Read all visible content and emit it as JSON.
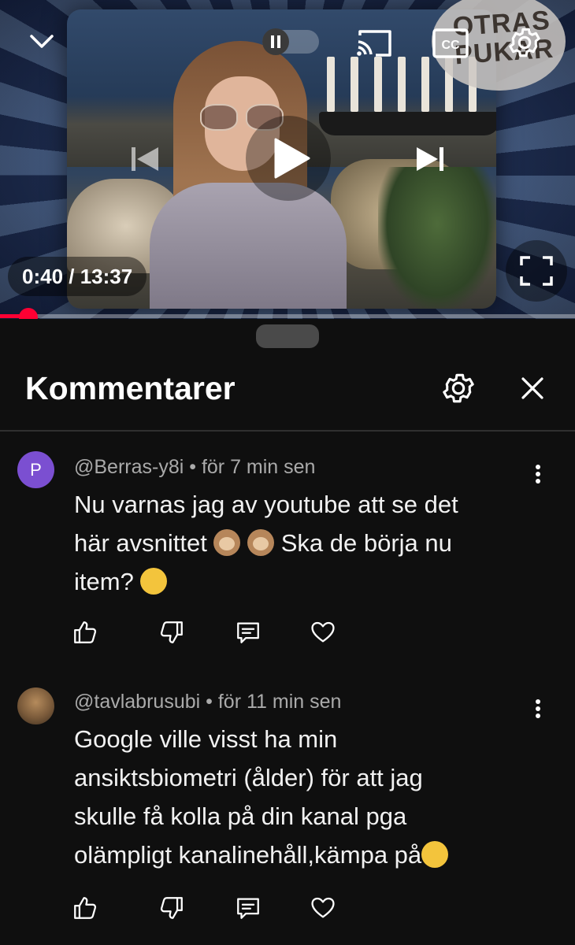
{
  "player": {
    "time_current": "0:40",
    "time_separator": " / ",
    "time_total": "13:37",
    "progress": 0.049,
    "logo_text_line1": "OTRAS",
    "logo_text_line2": "PUKAR",
    "state": "paused"
  },
  "comments_panel": {
    "title": "Kommentarer"
  },
  "comments": [
    {
      "avatar_letter": "P",
      "avatar_color": "#7b4fd1",
      "handle": "@Berras-y8i",
      "separator": " • ",
      "time": "för 7 min sen",
      "line1": "Nu varnas jag av youtube att se det",
      "line2_a": "här avsnittet ",
      "line2_b": "Ska de börja nu",
      "line3": "item? "
    },
    {
      "avatar_letter": "",
      "avatar_color": "#7a5a3a",
      "handle": "@tavlabrusubi",
      "separator": " • ",
      "time": "för 11 min sen",
      "line1": "Google ville visst ha min",
      "line2": "ansiktsbiometri (ålder) för att jag",
      "line3": "skulle få kolla på din kanal pga",
      "line4": "olämpligt kanalinehåll,kämpa på"
    }
  ],
  "icons": {
    "collapse": "chevron-down-icon",
    "pause": "pause-icon",
    "cast": "cast-icon",
    "captions": "cc-icon",
    "settings": "gear-icon",
    "previous": "skip-previous-icon",
    "play": "play-icon",
    "next": "skip-next-icon",
    "fullscreen": "fullscreen-icon",
    "close": "close-icon",
    "like": "thumb-up-icon",
    "dislike": "thumb-down-icon",
    "reply": "reply-icon",
    "heart": "heart-icon",
    "more": "kebab-icon"
  },
  "colors": {
    "progress": "#ff0033",
    "background": "#0f0f0f",
    "meta_text": "#aaaaaa"
  }
}
